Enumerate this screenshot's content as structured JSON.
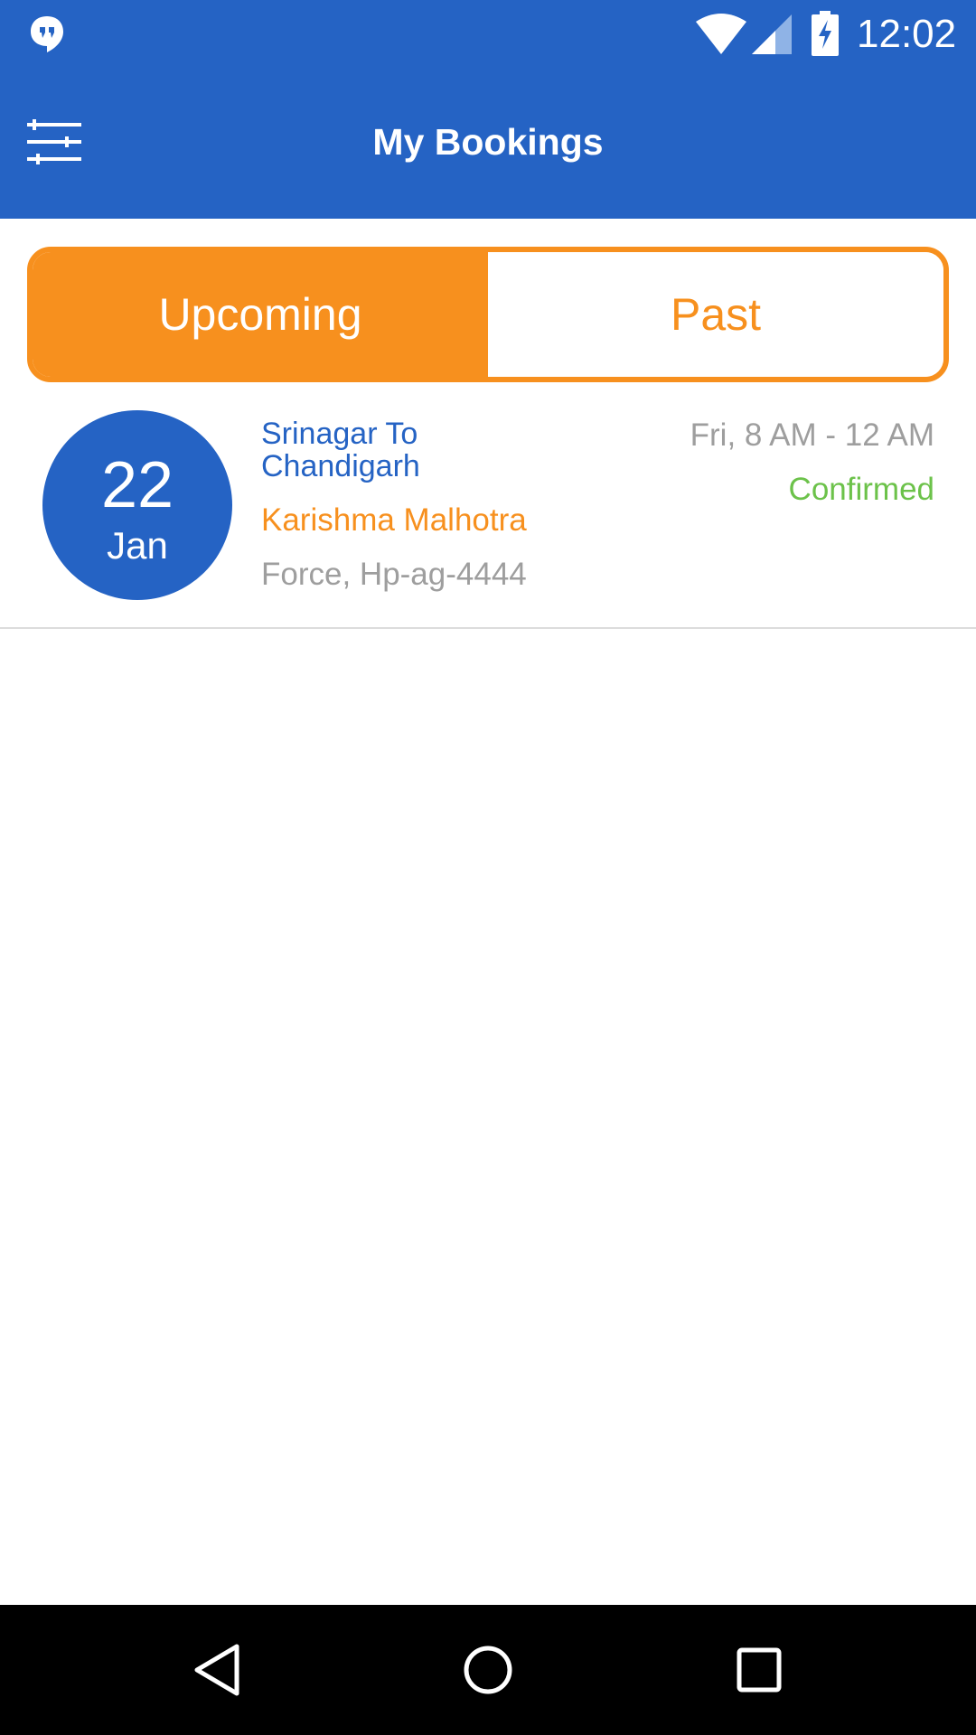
{
  "status_bar": {
    "time": "12:02",
    "icons": [
      "hangouts-icon",
      "wifi-icon",
      "signal-icon",
      "battery-charging-icon"
    ]
  },
  "app_bar": {
    "title": "My Bookings",
    "menu_icon": "filter-sliders-icon"
  },
  "tabs": {
    "upcoming_label": "Upcoming",
    "past_label": "Past",
    "selected": "Upcoming"
  },
  "bookings": [
    {
      "day": "22",
      "month": "Jan",
      "route": "Srinagar To Chandigarh",
      "passenger": "Karishma Malhotra",
      "vehicle": "Force, Hp-ag-4444",
      "time": "Fri, 8 AM - 12 AM",
      "status": "Confirmed"
    }
  ],
  "nav_bar": {
    "icons": [
      "back-icon",
      "home-icon",
      "recents-icon"
    ]
  },
  "colors": {
    "primary": "#2563c4",
    "accent": "#f7901e",
    "confirmed": "#6cc24a",
    "muted": "#9e9e9e"
  }
}
